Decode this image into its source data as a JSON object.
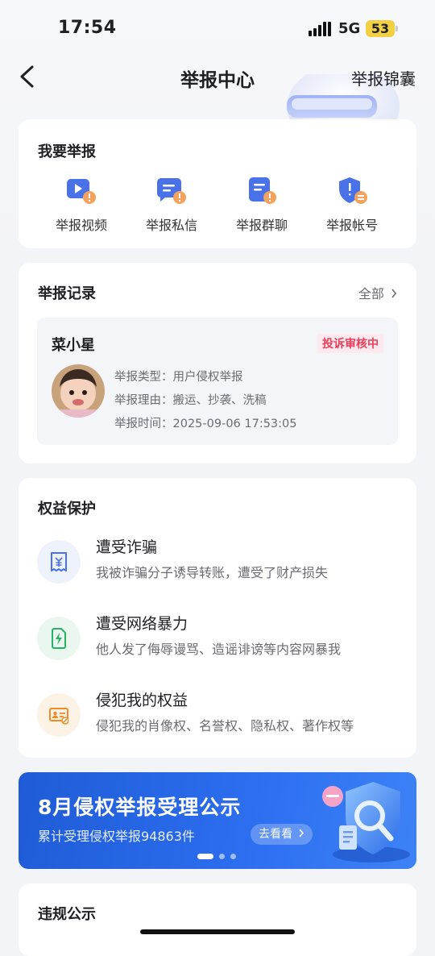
{
  "status_bar": {
    "time": "17:54",
    "network": "5G",
    "battery": "53"
  },
  "nav": {
    "title": "举报中心",
    "right_action": "举报锦囊"
  },
  "report_section": {
    "title": "我要举报",
    "actions": [
      {
        "label": "举报视频",
        "icon": "video-report-icon"
      },
      {
        "label": "举报私信",
        "icon": "message-report-icon"
      },
      {
        "label": "举报群聊",
        "icon": "group-report-icon"
      },
      {
        "label": "举报帐号",
        "icon": "account-report-icon"
      }
    ]
  },
  "records": {
    "title": "举报记录",
    "all_link": "全部",
    "item": {
      "name": "菜小星",
      "status": "投诉审核中",
      "type_line": "举报类型：用户侵权举报",
      "reason_line": "举报理由：搬运、抄袭、洗稿",
      "time_line": "举报时间：2025-09-06 17:53:05"
    }
  },
  "rights": {
    "title": "权益保护",
    "items": [
      {
        "title": "遭受诈骗",
        "subtitle": "我被诈骗分子诱导转账，遭受了财产损失",
        "icon": "yuan-receipt-icon",
        "color": "#4a72e8",
        "bg": "#eef2fc"
      },
      {
        "title": "遭受网络暴力",
        "subtitle": "他人发了侮辱谩骂、造谣诽谤等内容网暴我",
        "icon": "lightning-document-icon",
        "color": "#27b266",
        "bg": "#e9f7ef"
      },
      {
        "title": "侵犯我的权益",
        "subtitle": "侵犯我的肖像权、名誉权、隐私权、著作权等",
        "icon": "id-card-icon",
        "color": "#f08a24",
        "bg": "#fdf2e6"
      }
    ]
  },
  "banner": {
    "title": "8月侵权举报受理公示",
    "subtitle": "累计受理侵权举报94863件",
    "button": "去看看",
    "page_index": 1,
    "page_count": 3
  },
  "violations": {
    "title": "违规公示"
  },
  "colors": {
    "accent": "#4a72e8",
    "badge": "#ec3d5a",
    "banner": "#2d6ff0"
  }
}
